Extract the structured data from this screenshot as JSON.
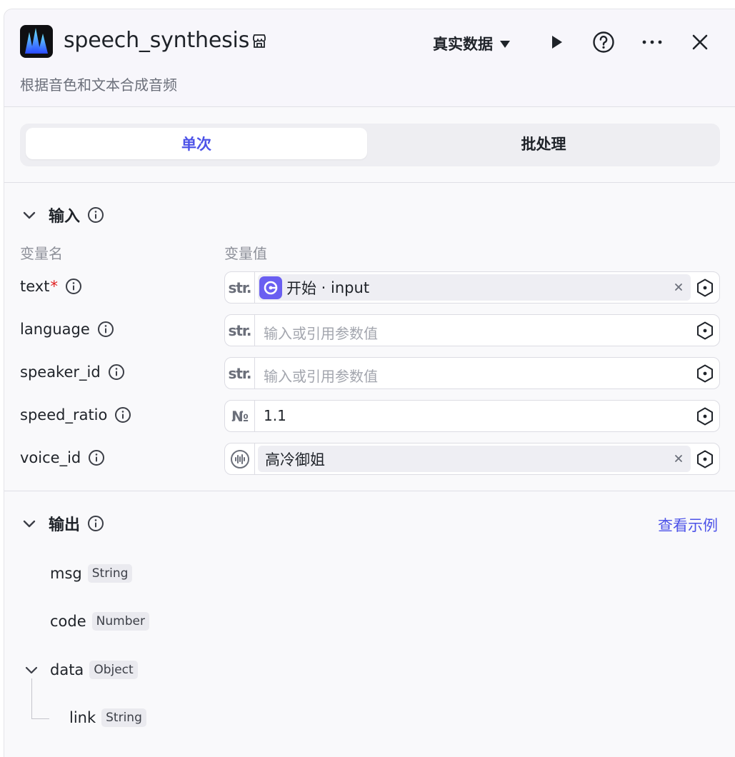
{
  "header": {
    "title": "speech_synthesis",
    "subtitle": "根据音色和文本合成音频",
    "data_mode": "真实数据",
    "icons": [
      "store-icon",
      "play-icon",
      "help-icon",
      "more-icon",
      "close-icon"
    ]
  },
  "tabs": [
    {
      "label": "单次",
      "active": true
    },
    {
      "label": "批处理",
      "active": false
    }
  ],
  "input": {
    "title": "输入",
    "column_name": "变量名",
    "column_value": "变量值",
    "rows": [
      {
        "name": "text",
        "required_mark": "*",
        "type": "str.",
        "ref_source": "开始",
        "ref_sep": " · ",
        "ref_var": "input"
      },
      {
        "name": "language",
        "type": "str.",
        "placeholder": "输入或引用参数值"
      },
      {
        "name": "speaker_id",
        "type": "str.",
        "placeholder": "输入或引用参数值"
      },
      {
        "name": "speed_ratio",
        "type": "№",
        "value": "1.1"
      },
      {
        "name": "voice_id",
        "type_icon": "voice-icon",
        "value": "高冷御姐"
      }
    ]
  },
  "output": {
    "title": "输出",
    "example_link": "查看示例",
    "fields": [
      {
        "name": "msg",
        "type": "String"
      },
      {
        "name": "code",
        "type": "Number"
      },
      {
        "name": "data",
        "type": "Object",
        "expanded": true
      },
      {
        "name": "link",
        "type": "String"
      }
    ]
  },
  "colors": {
    "accent": "#4d53e8",
    "required": "#e02020",
    "ref_icon": "#6a5ff1"
  }
}
